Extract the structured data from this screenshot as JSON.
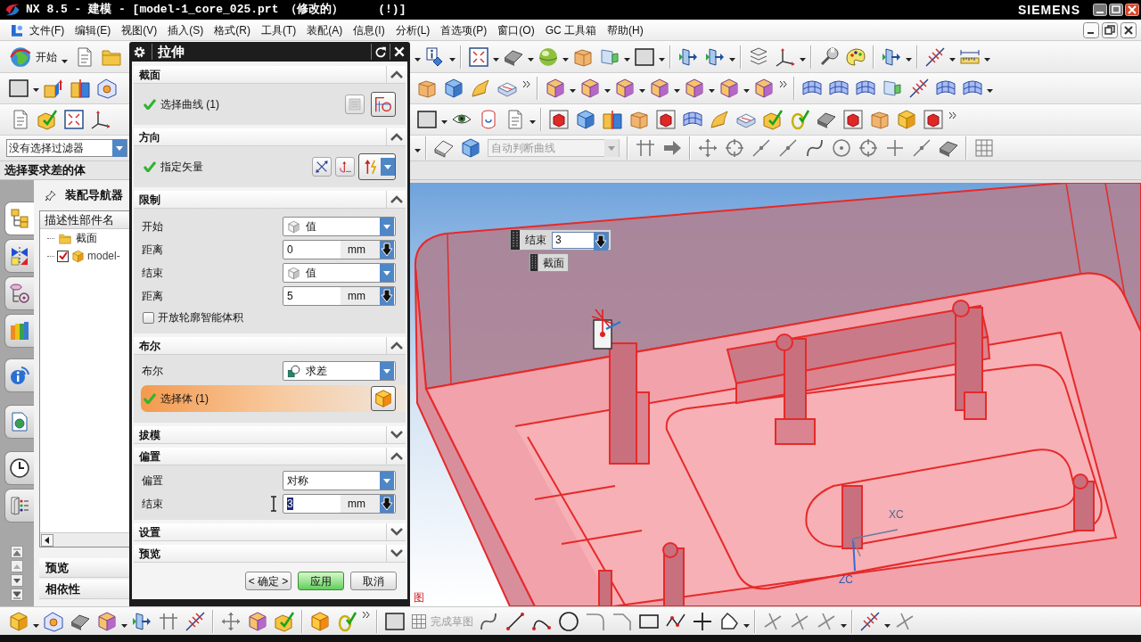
{
  "window": {
    "title": "NX 8.5 - 建模 - [model-1_core_025.prt （修改的）     (!)]",
    "brand": "SIEMENS"
  },
  "menu_bar": [
    "文件(F)",
    "编辑(E)",
    "视图(V)",
    "插入(S)",
    "格式(R)",
    "工具(T)",
    "装配(A)",
    "信息(I)",
    "分析(L)",
    "首选项(P)",
    "窗口(O)",
    "GC 工具箱",
    "帮助(H)"
  ],
  "toolbar": {
    "start_button": "开始"
  },
  "selection_bar": {
    "filter": "没有选择过滤器",
    "curve_rule": {
      "value": "自动判断曲线",
      "disabled": true
    }
  },
  "cue_line": "选择要求差的体",
  "resource_tabs": [
    {
      "selected": true
    },
    {
      "selected": false
    },
    {
      "selected": false
    },
    {
      "selected": false
    },
    {
      "selected": false
    },
    {
      "selected": false
    },
    {
      "selected": false
    },
    {
      "selected": false
    }
  ],
  "navigator": {
    "title": "装配导航器",
    "column": "描述性部件名",
    "tree": [
      {
        "kind": "folder",
        "label": "截面"
      },
      {
        "kind": "part",
        "label": "model-",
        "checked": true
      }
    ],
    "panels": [
      "预览",
      "相依性"
    ]
  },
  "dialog": {
    "title": "拉伸",
    "sections": [
      {
        "title": "截面",
        "expanded": true,
        "rows": [
          {
            "kind": "selection",
            "label": "选择曲线 (1)",
            "done": true,
            "active": false
          }
        ]
      },
      {
        "title": "方向",
        "expanded": true,
        "rows": [
          {
            "kind": "vector",
            "label": "指定矢量",
            "done": true
          }
        ]
      },
      {
        "title": "限制",
        "expanded": true,
        "rows": [
          {
            "kind": "dropdown",
            "label": "开始",
            "value": "值"
          },
          {
            "kind": "number",
            "label": "距离",
            "value": "0",
            "unit": "mm",
            "focused": false
          },
          {
            "kind": "dropdown",
            "label": "结束",
            "value": "值"
          },
          {
            "kind": "number",
            "label": "距离",
            "value": "5",
            "unit": "mm",
            "focused": false
          },
          {
            "kind": "checkbox",
            "label": "开放轮廓智能体积",
            "checked": false
          }
        ]
      },
      {
        "title": "布尔",
        "expanded": true,
        "rows": [
          {
            "kind": "dropdown",
            "label": "布尔",
            "value": "求差"
          },
          {
            "kind": "selection",
            "label": "选择体 (1)",
            "done": true,
            "active": true
          }
        ]
      },
      {
        "title": "拔模",
        "expanded": false
      },
      {
        "title": "偏置",
        "expanded": true,
        "rows": [
          {
            "kind": "dropdown",
            "label": "偏置",
            "value": "对称"
          },
          {
            "kind": "number",
            "label": "结束",
            "value": "3",
            "unit": "mm",
            "focused": true
          }
        ]
      },
      {
        "title": "设置",
        "expanded": false
      },
      {
        "title": "预览",
        "expanded": false
      }
    ],
    "buttons": [
      {
        "label": "< 确定 >",
        "highlighted": false
      },
      {
        "label": "应用",
        "highlighted": true
      },
      {
        "label": "取消",
        "highlighted": false
      }
    ]
  },
  "viewport": {
    "screen_input": {
      "label": "结束",
      "value": "3"
    },
    "screen_label": "截面",
    "axis_labels": [
      "XC",
      "ZC"
    ],
    "view_label": "图"
  },
  "sketch_toolbar": {
    "finish_sketch": {
      "label": "完成草图",
      "disabled": true
    }
  }
}
